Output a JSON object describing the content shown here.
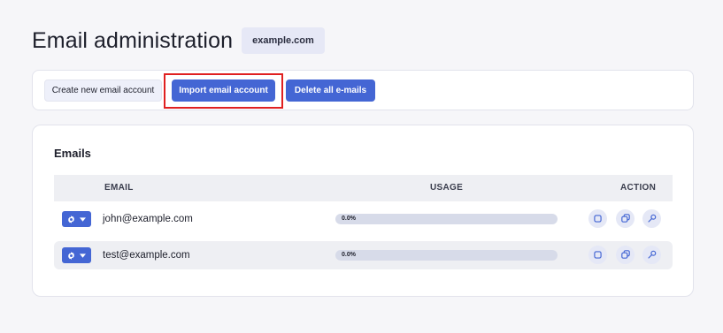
{
  "page": {
    "title": "Email administration",
    "domain": "example.com"
  },
  "toolbar": {
    "create_label": "Create new email account",
    "import_label": "Import email account",
    "delete_all_label": "Delete all e-mails"
  },
  "emails": {
    "title": "Emails",
    "columns": {
      "email": "EMAIL",
      "usage": "USAGE",
      "action": "ACTION"
    },
    "rows": [
      {
        "email": "john@example.com",
        "usage_label": "0.0%",
        "usage_fraction": 0.0
      },
      {
        "email": "test@example.com",
        "usage_label": "0.0%",
        "usage_fraction": 0.0
      }
    ]
  },
  "icons": {
    "gear": "gear-icon",
    "caret": "caret-down-icon",
    "edit": "square-icon",
    "copy": "copy-icon",
    "key": "key-icon"
  },
  "colors": {
    "primary": "#4466d4",
    "highlight": "#e02020",
    "badge_bg": "#e6e8f6",
    "row_alt": "#eeeff3"
  }
}
